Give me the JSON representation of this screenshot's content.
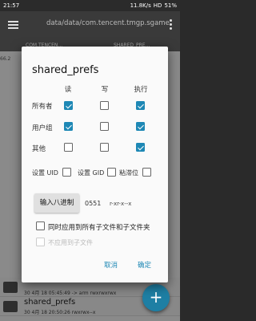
{
  "status_bar": {
    "time": "21:57",
    "speed": "11.8K/s",
    "network": "HD",
    "battery": "51%"
  },
  "app_bar": {
    "path": "data/data/com.tencent.tmgp.sgame"
  },
  "breadcrumbs": [
    "COM.TENCEN...",
    "SHARED_PRE..."
  ],
  "background_list": {
    "size_hint": "66.2",
    "items": [
      {
        "name": "",
        "meta": "30 4月 18 05:45:49  -> arm  rwxrwxrwx",
        "size": ""
      },
      {
        "name": "shared_prefs",
        "meta": "30 4月 18 20:50:26   rwxrwx--x",
        "size": ""
      }
    ]
  },
  "dialog": {
    "title": "shared_prefs",
    "columns": [
      "读",
      "写",
      "执行"
    ],
    "rows": [
      {
        "label": "所有者",
        "checks": [
          true,
          false,
          true
        ]
      },
      {
        "label": "用户组",
        "checks": [
          true,
          false,
          true
        ]
      },
      {
        "label": "其他",
        "checks": [
          false,
          false,
          true
        ]
      }
    ],
    "flags": [
      {
        "label": "设置 UID",
        "checked": false
      },
      {
        "label": "设置 GID",
        "checked": false
      },
      {
        "label": "粘滞位",
        "checked": false
      }
    ],
    "octal_button": "输入八进制",
    "octal_value": "0551",
    "permission_string": "r-xr-x--x",
    "apply_recursive": {
      "label": "同时应用到所有子文件和子文件夹",
      "checked": false
    },
    "apply_files_only": {
      "label": "不应用到子文件",
      "checked": false,
      "disabled": true
    },
    "cancel": "取消",
    "ok": "确定"
  },
  "fab": {
    "icon": "plus-icon",
    "glyph": "+"
  },
  "colors": {
    "accent": "#1e88b5",
    "fab": "#1e7fa4"
  }
}
